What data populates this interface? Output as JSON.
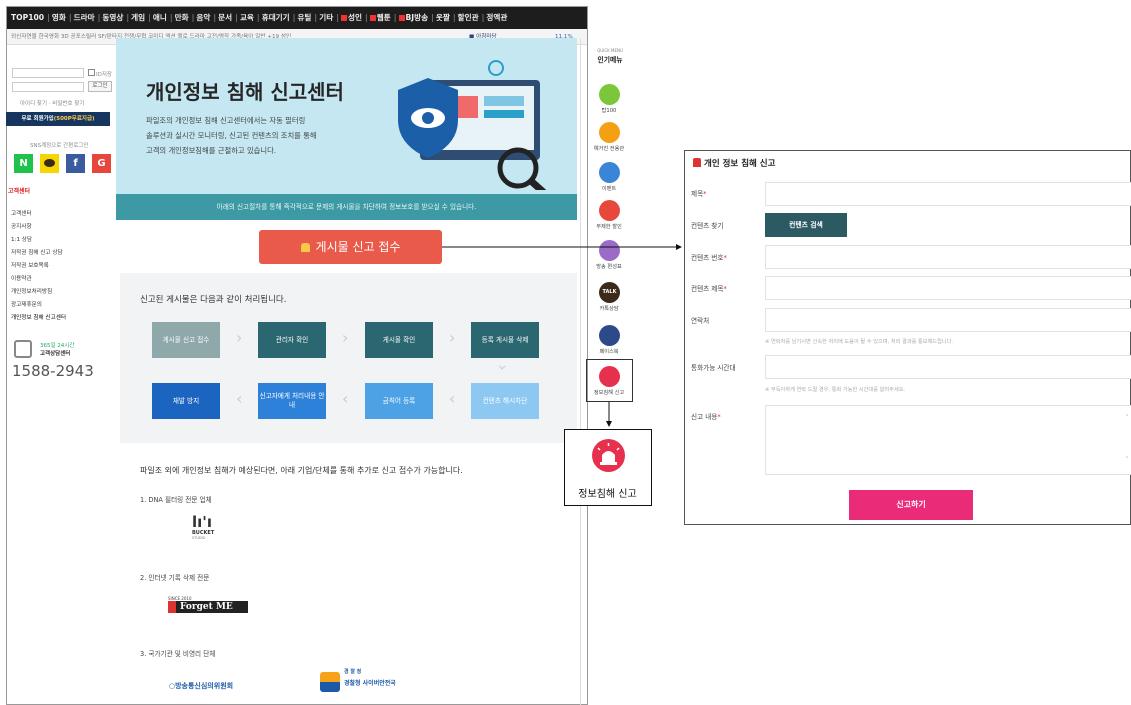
{
  "topnav": [
    "TOP100",
    "영화",
    "드라마",
    "동영상",
    "게임",
    "애니",
    "만화",
    "음악",
    "문서",
    "교육",
    "휴대기기",
    "유틸",
    "기타",
    "성인",
    "웹툰",
    "BJ방송",
    "웃짤",
    "할인관",
    "정액관"
  ],
  "subnav": {
    "links": "외신자연물  한국영화  3D  공포스릴러  SF/판타지  전쟁/무협  코미디  액션  멜로  드라마  고전/명작  가족/육아  일반  +19 성인",
    "stock": "아침마당",
    "pct": "11.1%"
  },
  "login": {
    "save_label": "ID저장",
    "login_btn": "로그인",
    "find": "아이디 찾기 · 비밀번호 찾기",
    "join": "무료 회원가입",
    "join_bonus": "(500P무료지급)",
    "sns": "SNS계정으로 간편로그인"
  },
  "sns_buttons": [
    "N",
    "",
    "f",
    "G"
  ],
  "cs": {
    "title": "고객센터",
    "items": [
      "고객센터",
      "공지사항",
      "1:1 상담",
      "저작권 침해 신고 상담",
      "저작권 보호목록",
      "이용약관",
      "개인정보처리방침",
      "광고제휴문의",
      "개인정보 침해 신고센터"
    ],
    "hours": "365일 24시간",
    "hours2": "고객상담센터",
    "phone": "1588-2943"
  },
  "hero": {
    "title": "개인정보 침해 신고센터",
    "desc": [
      "파일조의 개인정보 침해 신고센터에서는 자동 필터링",
      "솔루션과 실시간 모니터링, 신고된 컨텐츠의 조치를 통해",
      "고객의 개인정보침해를 근절하고 있습니다."
    ],
    "strip": "아래의 신고절차를 통해 즉각적으로 문제의 게시물을 차단하여 정보보호를 받으실 수 있습니다.",
    "report_btn": "게시물 신고 접수"
  },
  "process": {
    "title": "신고된 게시물은 다음과 같이 처리됩니다.",
    "row1": [
      "게시물 신고 접수",
      "관리자 확인",
      "게시물 확인",
      "등록 게시물 삭제"
    ],
    "row2": [
      "재발 방지",
      "신고자에게 처리내용 안내",
      "금칙어 등록",
      "컨텐츠 해시차단"
    ]
  },
  "other": {
    "title": "파일조 외에 개인정보 침해가 예상된다면, 아래 기업/단체를 통해 추가로 신고 접수가 가능합니다.",
    "cats": [
      "1. DNA 필터링 전문 업체",
      "2. 인터넷 기록 삭제 전문",
      "3. 국가기관 및 비영리 단체"
    ],
    "logo1": "BUCKET",
    "logo1_sub": "STUDIO",
    "logo2_top": "SINCE 2010",
    "logo2": "Forget ME",
    "logo3": "방송통신심의위원회",
    "logo4": "경찰청 사이버안전국",
    "logo4_top": "경 찰 청"
  },
  "rmenu": {
    "sub": "QUICK MENU",
    "head": "인기메뉴",
    "items": [
      {
        "label": "탑100",
        "color": "#7cc63a"
      },
      {
        "label": "예거진 전용관",
        "color": "#f5a013"
      },
      {
        "label": "이벤트",
        "color": "#3a85d8"
      },
      {
        "label": "무제한 할인",
        "color": "#e8473c"
      },
      {
        "label": "방송 편성표",
        "color": "#9a6cc8"
      },
      {
        "label": "카톡상담",
        "color": "#3c2b1a"
      },
      {
        "label": "페이스북",
        "color": "#2c4a8a"
      },
      {
        "label": "정보침해 신고",
        "color": "#e7304e"
      }
    ],
    "talk": "TALK"
  },
  "zoom": {
    "label": "정보침해 신고"
  },
  "form": {
    "title": "개인 정보 침해 신고",
    "fields": [
      {
        "label": "제목",
        "req": "*"
      },
      {
        "label": "컨텐츠 찾기",
        "req": ""
      },
      {
        "label": "컨텐츠 번호",
        "req": "*"
      },
      {
        "label": "컨텐츠 제목",
        "req": "*"
      },
      {
        "label": "연락처",
        "req": ""
      },
      {
        "label": "통화가능 시간대",
        "req": ""
      },
      {
        "label": "신고 내용",
        "req": "*"
      }
    ],
    "search_btn": "컨텐츠 검색",
    "note1": "※ 연락처를 남기시면 신속한 처리에 도움이 될 수 있으며, 처리 결과를 통보해드립니다.",
    "note2": "※ 부득이하게 연락 드릴 경우, 통화 가능한 시간대를 알려주세요.",
    "submit": "신고하기"
  },
  "colors": {
    "accent": "#ea5a4b",
    "teal": "#3d9aa5",
    "submit": "#ea2b78",
    "step_dark": "#2a6770",
    "step_blue": "#1b64c0"
  }
}
